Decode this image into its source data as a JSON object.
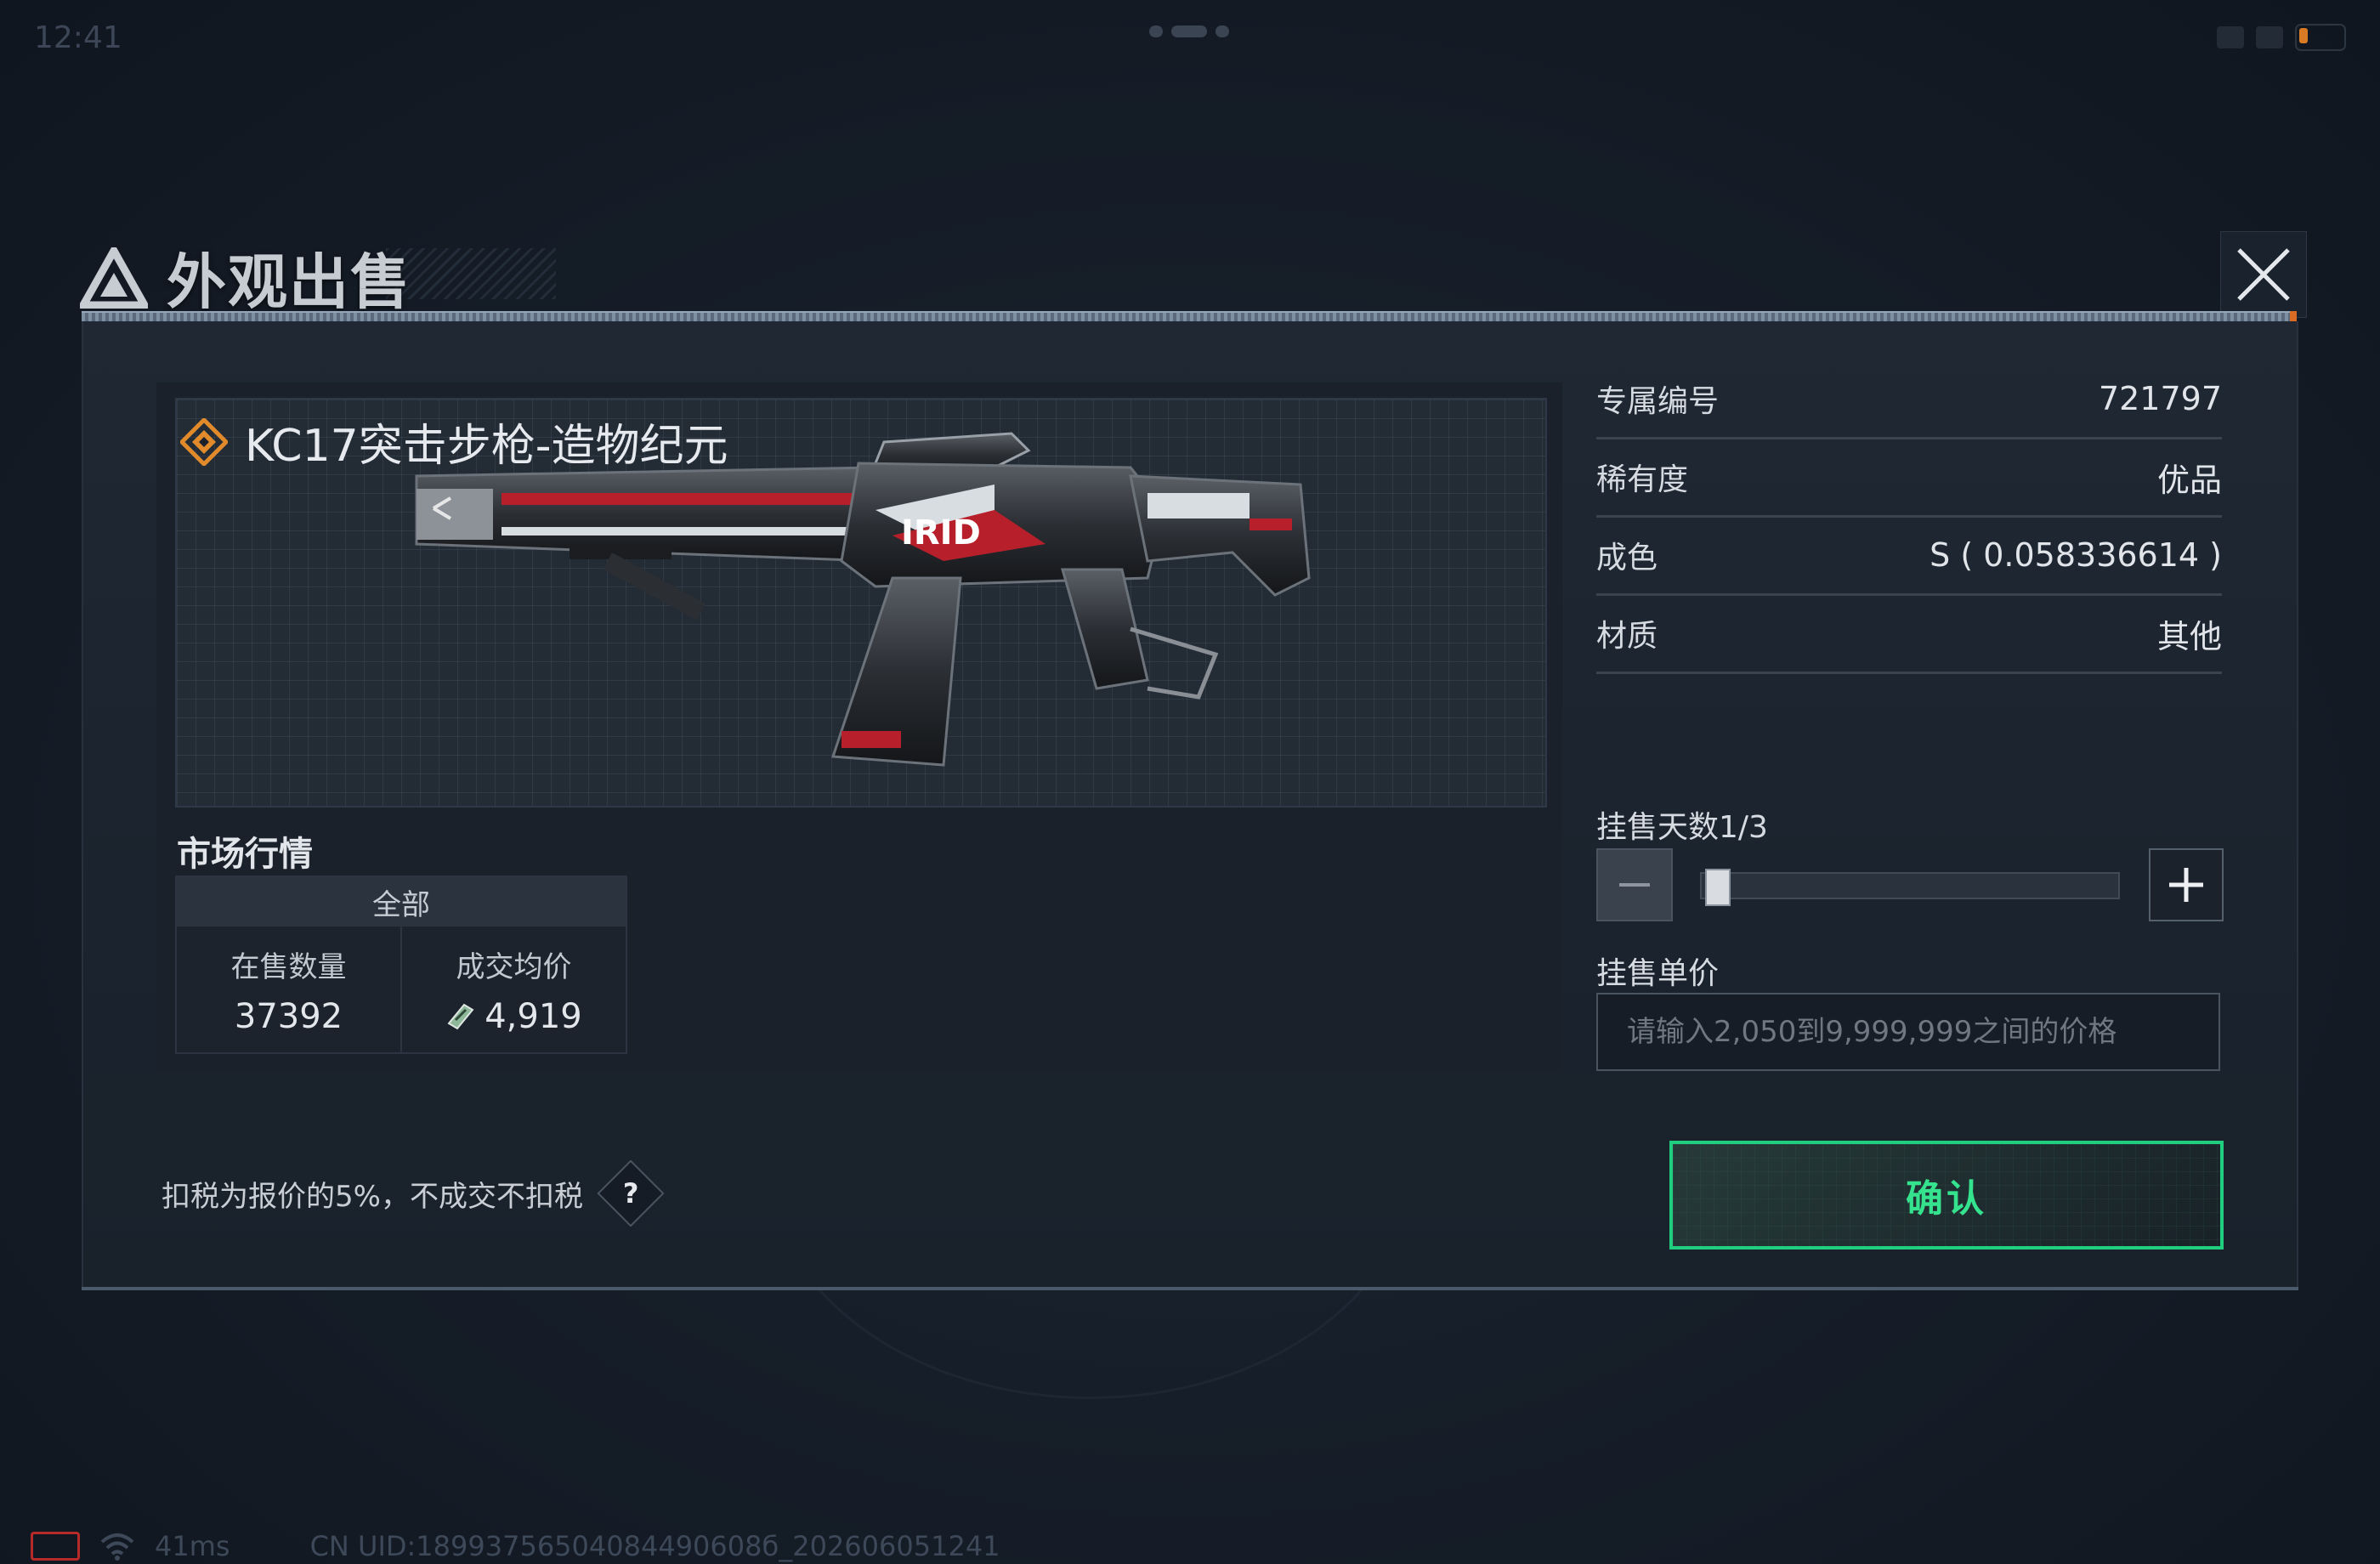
{
  "status_bar": {
    "time": "12:41"
  },
  "dialog": {
    "title": "外观出售"
  },
  "item": {
    "name": "KC17突击步枪-造物纪元"
  },
  "market": {
    "title": "市场行情",
    "tab_label": "全部",
    "on_sale_label": "在售数量",
    "on_sale_value": "37392",
    "avg_price_label": "成交均价",
    "avg_price_value": "4,919"
  },
  "properties": [
    {
      "label": "专属编号",
      "value": "721797"
    },
    {
      "label": "稀有度",
      "value": "优品"
    },
    {
      "label": "成色",
      "value": "S ( 0.058336614 )"
    },
    {
      "label": "材质",
      "value": "其他"
    }
  ],
  "listing": {
    "days_label": "挂售天数1/3",
    "days_current": 1,
    "days_max": 3,
    "price_label": "挂售单价",
    "price_placeholder": "请输入2,050到9,999,999之间的价格",
    "price_value": ""
  },
  "tax_note": "扣税为报价的5%，不成交不扣税",
  "help_label": "?",
  "confirm_label": "确认",
  "footer": {
    "ping": "41ms",
    "uid": "CN UID:18993756504084490608б_202606051241"
  },
  "colors": {
    "accent_green": "#1fcf7f",
    "rarity_orange": "#e08a2c",
    "header_stripe_orange": "#d96b24"
  },
  "icons": {
    "title": "triangle-logo-icon",
    "close": "close-icon",
    "rarity": "diamond-rarity-icon",
    "currency": "currency-note-icon",
    "minus": "minus-icon",
    "plus": "plus-icon",
    "help": "question-icon",
    "wifi": "wifi-icon",
    "battery": "battery-icon"
  }
}
